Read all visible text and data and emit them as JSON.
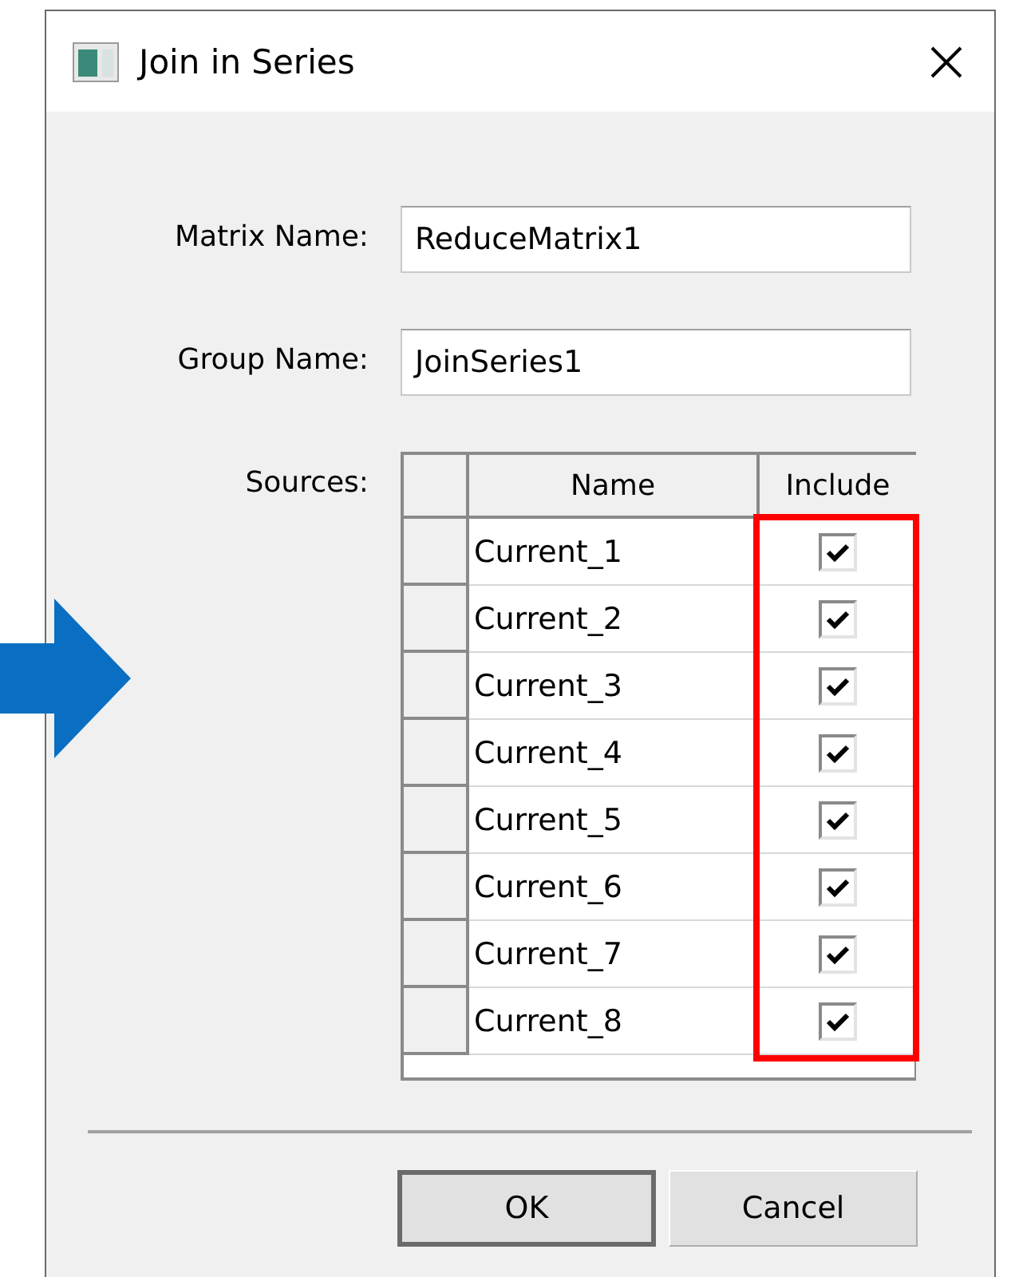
{
  "window": {
    "title": "Join in Series"
  },
  "fields": [
    {
      "label": "Matrix Name:",
      "value": "ReduceMatrix1"
    },
    {
      "label": "Group Name:",
      "value": "JoinSeries1"
    }
  ],
  "sources": {
    "label": "Sources:",
    "columns": [
      "Name",
      "Include"
    ],
    "rows": [
      {
        "name": "Current_1",
        "checked": true
      },
      {
        "name": "Current_2",
        "checked": true
      },
      {
        "name": "Current_3",
        "checked": true
      },
      {
        "name": "Current_4",
        "checked": true
      },
      {
        "name": "Current_5",
        "checked": true
      },
      {
        "name": "Current_6",
        "checked": true
      },
      {
        "name": "Current_7",
        "checked": true
      },
      {
        "name": "Current_8",
        "checked": true
      }
    ]
  },
  "buttons": [
    {
      "label": "OK",
      "default": true
    },
    {
      "label": "Cancel",
      "default": false
    }
  ]
}
